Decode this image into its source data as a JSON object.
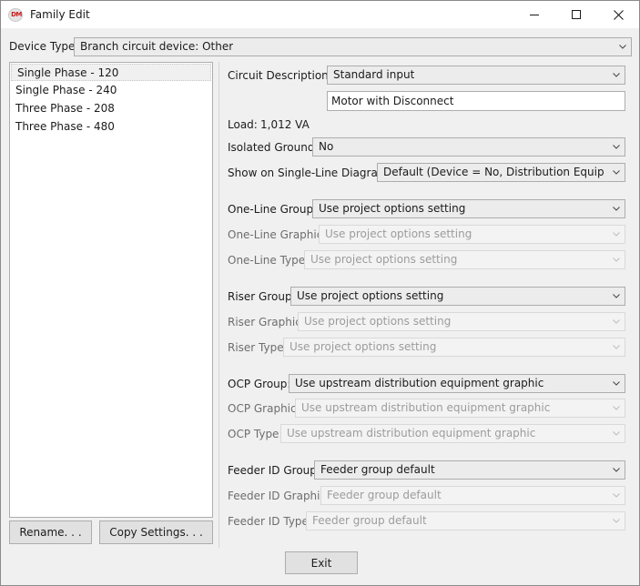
{
  "window": {
    "title": "Family Edit",
    "icon_text": "DM"
  },
  "device_type": {
    "label": "Device Type:",
    "value": "Branch circuit device: Other"
  },
  "families": [
    {
      "label": "Single Phase - 120"
    },
    {
      "label": "Single Phase - 240"
    },
    {
      "label": "Three Phase - 208"
    },
    {
      "label": "Three Phase - 480"
    }
  ],
  "buttons": {
    "rename": "Rename. . .",
    "copy_settings": "Copy Settings. . .",
    "exit": "Exit"
  },
  "circuit_description": {
    "label": "Circuit Description:",
    "value": "Standard input",
    "text": "Motor with Disconnect"
  },
  "load": {
    "label": "Load:",
    "value": "1,012 VA"
  },
  "isolated_ground": {
    "label": "Isolated Ground:",
    "value": "No"
  },
  "single_line": {
    "label": "Show on Single-Line Diagram:",
    "value": "Default (Device = No, Distribution Equipment"
  },
  "one_line": {
    "group_label": "One-Line Group:",
    "group_value": "Use project options setting",
    "graphic_label": "One-Line Graphic:",
    "graphic_value": "Use project options setting",
    "type_label": "One-Line Type:",
    "type_value": "Use project options setting"
  },
  "riser": {
    "group_label": "Riser Group:",
    "group_value": "Use project options setting",
    "graphic_label": "Riser Graphic:",
    "graphic_value": "Use project options setting",
    "type_label": "Riser Type:",
    "type_value": "Use project options setting"
  },
  "ocp": {
    "group_label": "OCP Group:",
    "group_value": "Use upstream distribution equipment graphic",
    "graphic_label": "OCP Graphic:",
    "graphic_value": "Use upstream distribution equipment graphic",
    "type_label": "OCP Type:",
    "type_value": "Use upstream distribution equipment graphic"
  },
  "feeder_id": {
    "group_label": "Feeder ID Group:",
    "group_value": "Feeder group default",
    "graphic_label": "Feeder ID Graphic:",
    "graphic_value": "Feeder group default",
    "type_label": "Feeder ID Type:",
    "type_value": "Feeder group default"
  }
}
